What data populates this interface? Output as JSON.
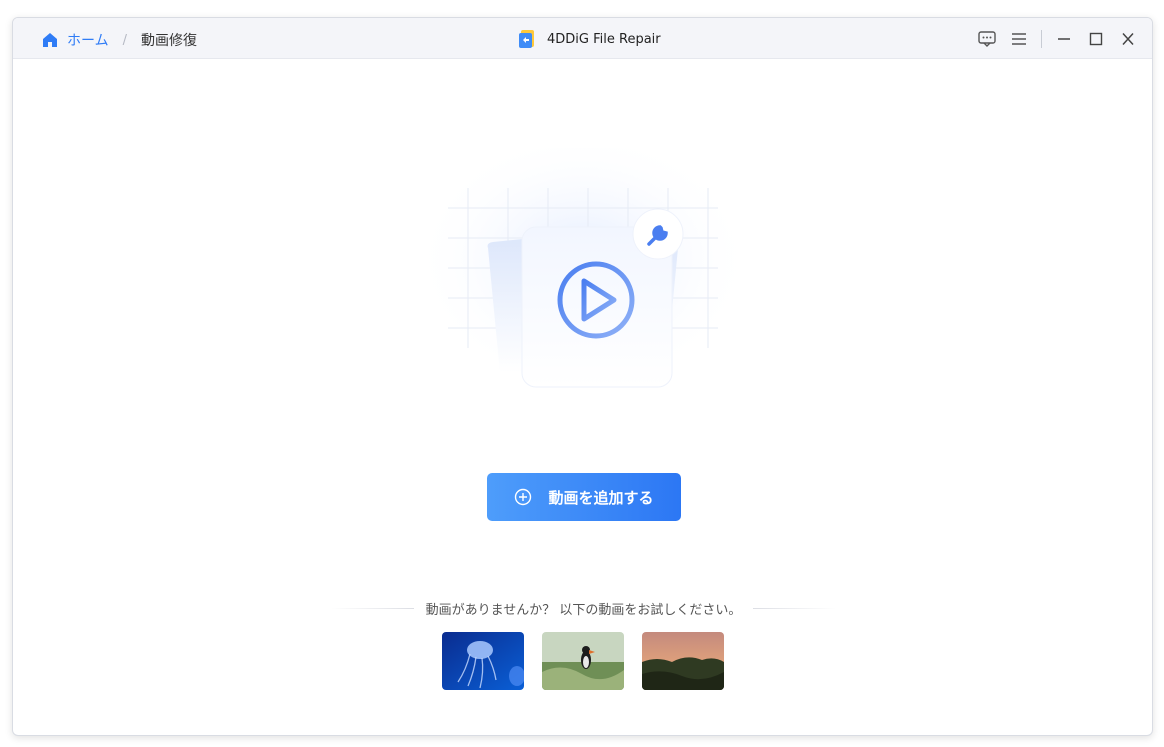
{
  "breadcrumb": {
    "home_label": "ホーム",
    "separator": "/",
    "current_label": "動画修復"
  },
  "app": {
    "title": "4DDiG File Repair"
  },
  "window_controls": {
    "icons": [
      "feedback-icon",
      "menu-icon",
      "minimize-icon",
      "maximize-icon",
      "close-icon"
    ]
  },
  "main": {
    "add_button_label": "動画を追加する",
    "sample_prompt": "動画がありませんか？ 以下の動画をお試しください。",
    "sample_videos": [
      "jellyfish",
      "puffin",
      "sunset-forest"
    ]
  },
  "colors": {
    "accent": "#2f7cf6",
    "button_start": "#4e9dfb",
    "button_end": "#2c77f4"
  }
}
